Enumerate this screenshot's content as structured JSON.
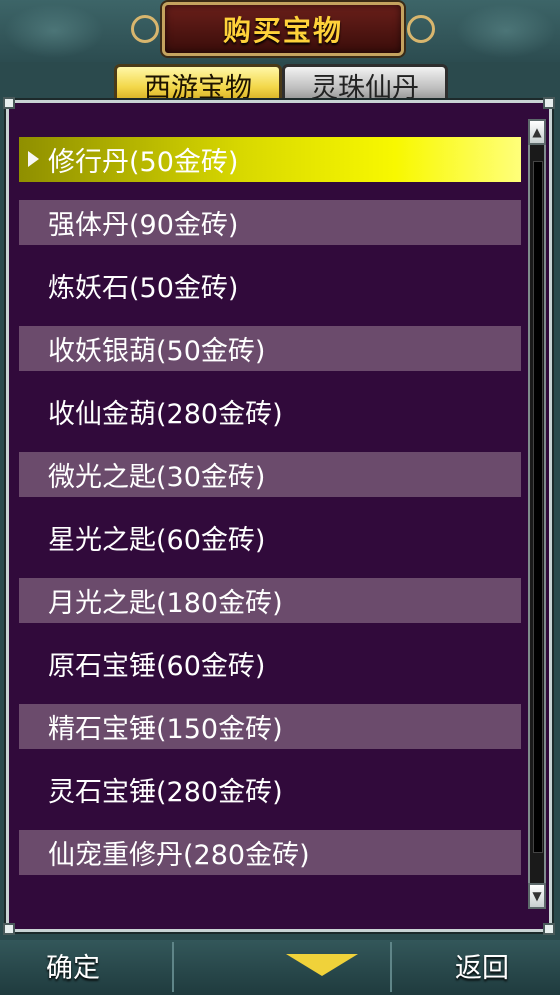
{
  "header": {
    "title": "购买宝物"
  },
  "tabs": [
    {
      "label": "西游宝物",
      "active": true
    },
    {
      "label": "灵珠仙丹",
      "active": false
    }
  ],
  "items": [
    {
      "label": "修行丹(50金砖)"
    },
    {
      "label": "强体丹(90金砖)"
    },
    {
      "label": "炼妖石(50金砖)"
    },
    {
      "label": "收妖银葫(50金砖)"
    },
    {
      "label": "收仙金葫(280金砖)"
    },
    {
      "label": "微光之匙(30金砖)"
    },
    {
      "label": "星光之匙(60金砖)"
    },
    {
      "label": "月光之匙(180金砖)"
    },
    {
      "label": "原石宝锤(60金砖)"
    },
    {
      "label": "精石宝锤(150金砖)"
    },
    {
      "label": "灵石宝锤(280金砖)"
    },
    {
      "label": "仙宠重修丹(280金砖)"
    }
  ],
  "selected_index": 0,
  "footer": {
    "confirm_label": "确定",
    "back_label": "返回"
  },
  "icons": {
    "selection_pointer": "pointer-triangle-icon",
    "scroll_up": "arrow-up-icon",
    "scroll_down": "arrow-down-icon",
    "page_down": "chevron-down-icon"
  },
  "colors": {
    "panel_bg": "#310a3b",
    "row_shaded": "#6b4b6c",
    "selected_row": "#f8f800",
    "title_text": "#ffd23a"
  }
}
